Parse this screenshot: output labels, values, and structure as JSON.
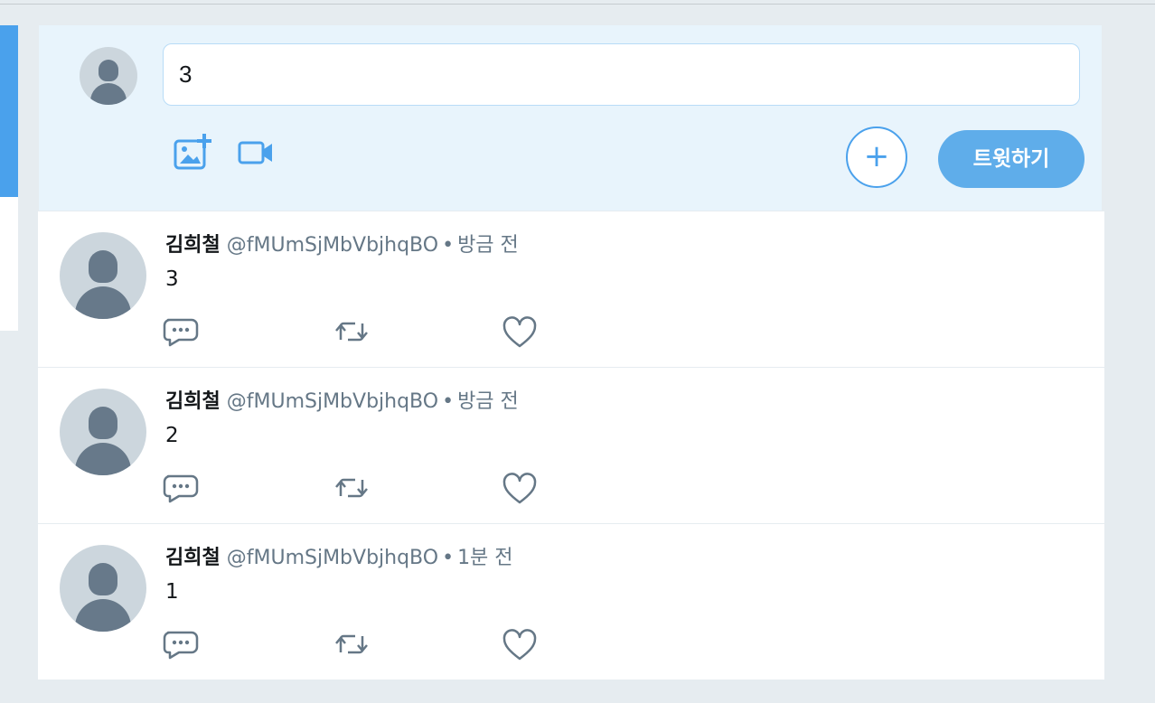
{
  "composer": {
    "input_value": "3",
    "plus_label": "+",
    "tweet_button_label": "트윗하기"
  },
  "colors": {
    "accent": "#4aa1ec",
    "composer_bg": "#e8f4fc",
    "muted_text": "#657786"
  },
  "icons": {
    "photo": "photo-add-icon",
    "video": "video-icon",
    "reply": "reply-icon",
    "retweet": "retweet-icon",
    "like": "heart-icon"
  },
  "tweets": [
    {
      "name": "김희철",
      "handle": "@fMUmSjMbVbjhqBO",
      "separator": "•",
      "time": "방금 전",
      "text": "3"
    },
    {
      "name": "김희철",
      "handle": "@fMUmSjMbVbjhqBO",
      "separator": "•",
      "time": "방금 전",
      "text": "2"
    },
    {
      "name": "김희철",
      "handle": "@fMUmSjMbVbjhqBO",
      "separator": "•",
      "time": "1분 전",
      "text": "1"
    }
  ]
}
